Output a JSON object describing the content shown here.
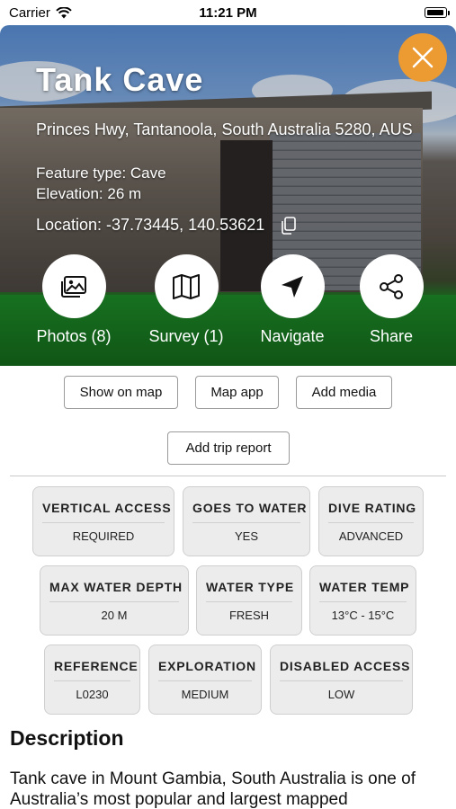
{
  "status_bar": {
    "carrier": "Carrier",
    "time": "11:21 PM"
  },
  "cave": {
    "name": "Tank Cave",
    "address": "Princes Hwy, Tantanoola, South Australia 5280, AUS",
    "feature_type": "Feature type: Cave",
    "elevation": "Elevation: 26 m",
    "location": "Location: -37.73445, 140.53621"
  },
  "actions": [
    {
      "label": "Photos (8)",
      "icon": "photos-icon"
    },
    {
      "label": "Survey (1)",
      "icon": "map-icon"
    },
    {
      "label": "Navigate",
      "icon": "navigate-icon"
    },
    {
      "label": "Share",
      "icon": "share-icon"
    }
  ],
  "buttons": {
    "show_on_map": "Show on map",
    "map_app": "Map app",
    "add_media": "Add media",
    "add_trip_report": "Add trip report"
  },
  "attributes": [
    {
      "key": "VERTICAL ACCESS",
      "value": "REQUIRED"
    },
    {
      "key": "GOES TO WATER",
      "value": "YES"
    },
    {
      "key": "DIVE RATING",
      "value": "ADVANCED"
    },
    {
      "key": "MAX WATER DEPTH",
      "value": "20 M"
    },
    {
      "key": "WATER TYPE",
      "value": "FRESH"
    },
    {
      "key": "WATER TEMP",
      "value": "13°C - 15°C"
    },
    {
      "key": "REFERENCE",
      "value": "L0230"
    },
    {
      "key": "EXPLORATION",
      "value": "MEDIUM"
    },
    {
      "key": "DISABLED ACCESS",
      "value": "LOW"
    }
  ],
  "description": {
    "title": "Description",
    "text": "Tank cave in Mount Gambia, South Australia is one of Australia’s most popular and largest mapped"
  },
  "colors": {
    "close_button": "#ec9a32",
    "card_bg": "#ececec"
  }
}
